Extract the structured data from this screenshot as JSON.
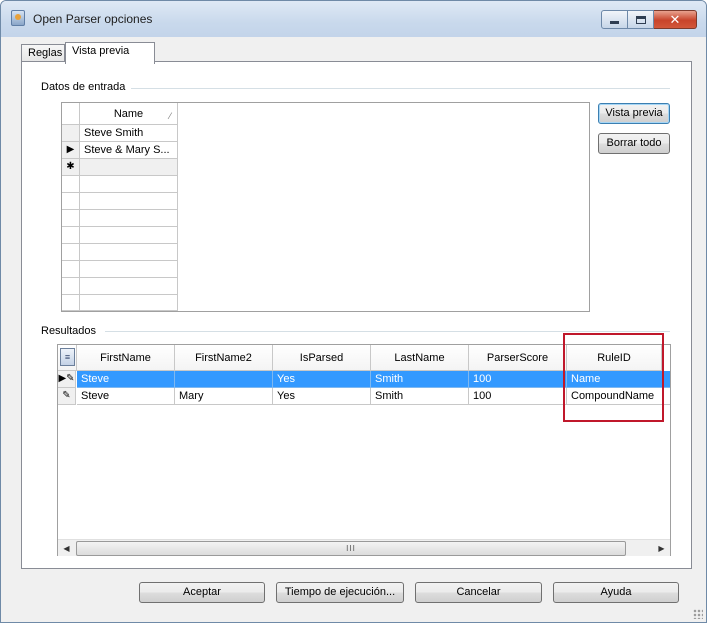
{
  "window": {
    "title": "Open Parser opciones"
  },
  "tabs": [
    {
      "label": "Reglas",
      "active": false
    },
    {
      "label": "Vista previa",
      "active": true
    }
  ],
  "input_section": {
    "label": "Datos de entrada",
    "grid": {
      "column_header": "Name",
      "rows": [
        {
          "marker": "",
          "value": "Steve Smith"
        },
        {
          "marker": "▶",
          "value": "Steve & Mary S..."
        },
        {
          "marker": "✱",
          "value": ""
        }
      ]
    },
    "preview_button": "Vista previa",
    "clear_button": "Borrar todo"
  },
  "results_section": {
    "label": "Resultados",
    "columns": [
      "FirstName",
      "FirstName2",
      "IsParsed",
      "LastName",
      "ParserScore",
      "RuleID"
    ],
    "rows": [
      {
        "marker": "▶✎",
        "selected": true,
        "cells": [
          "Steve",
          "",
          "Yes",
          "Smith",
          "100",
          "Name"
        ]
      },
      {
        "marker": "✎",
        "selected": false,
        "cells": [
          "Steve",
          "Mary",
          "Yes",
          "Smith",
          "100",
          "CompoundName"
        ]
      }
    ],
    "scroll_grip": "III"
  },
  "footer": {
    "accept": "Aceptar",
    "runtime": "Tiempo de ejecución...",
    "cancel": "Cancelar",
    "help": "Ayuda"
  },
  "colors": {
    "selection": "#3399ff",
    "highlight_border": "#c0182b"
  }
}
